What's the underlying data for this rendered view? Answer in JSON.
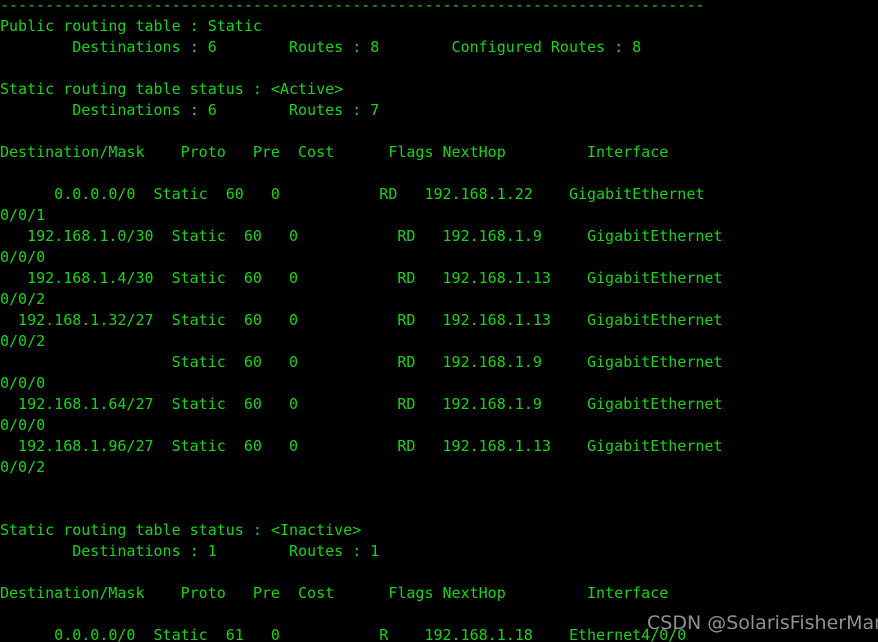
{
  "terminal": {
    "foreground_color": "#16d516",
    "background_color": "#000000",
    "separator": "------------------------------------------------------------------------------",
    "public_table": {
      "label": "Public routing table : Static",
      "summary": "        Destinations : 6        Routes : 8        Configured Routes : 8",
      "destinations_label": "Destinations",
      "destinations_value": "6",
      "routes_label": "Routes",
      "routes_value": "8",
      "configured_routes_label": "Configured Routes",
      "configured_routes_value": "8"
    },
    "active_section": {
      "status_line": "Static routing table status : <Active>",
      "status_label": "Static routing table status",
      "status_value": "<Active>",
      "summary": "        Destinations : 6        Routes : 7",
      "destinations_value": "6",
      "routes_value": "7",
      "header": "Destination/Mask    Proto   Pre  Cost      Flags NextHop         Interface",
      "columns": [
        "Destination/Mask",
        "Proto",
        "Pre",
        "Cost",
        "Flags",
        "NextHop",
        "Interface"
      ],
      "rows": [
        {
          "line1": "      0.0.0.0/0  Static  60   0           RD   192.168.1.22    GigabitEthernet",
          "line2": "0/0/1",
          "destination": "0.0.0.0/0",
          "proto": "Static",
          "pre": "60",
          "cost": "0",
          "flags": "RD",
          "nexthop": "192.168.1.22",
          "interface": "GigabitEthernet0/0/1"
        },
        {
          "line1": "   192.168.1.0/30  Static  60   0           RD   192.168.1.9     GigabitEthernet",
          "line2": "0/0/0",
          "destination": "192.168.1.0/30",
          "proto": "Static",
          "pre": "60",
          "cost": "0",
          "flags": "RD",
          "nexthop": "192.168.1.9",
          "interface": "GigabitEthernet0/0/0"
        },
        {
          "line1": "   192.168.1.4/30  Static  60   0           RD   192.168.1.13    GigabitEthernet",
          "line2": "0/0/2",
          "destination": "192.168.1.4/30",
          "proto": "Static",
          "pre": "60",
          "cost": "0",
          "flags": "RD",
          "nexthop": "192.168.1.13",
          "interface": "GigabitEthernet0/0/2"
        },
        {
          "line1": "  192.168.1.32/27  Static  60   0           RD   192.168.1.13    GigabitEthernet",
          "line2": "0/0/2",
          "destination": "192.168.1.32/27",
          "proto": "Static",
          "pre": "60",
          "cost": "0",
          "flags": "RD",
          "nexthop": "192.168.1.13",
          "interface": "GigabitEthernet0/0/2"
        },
        {
          "line1": "                   Static  60   0           RD   192.168.1.9     GigabitEthernet",
          "line2": "0/0/0",
          "destination": "",
          "proto": "Static",
          "pre": "60",
          "cost": "0",
          "flags": "RD",
          "nexthop": "192.168.1.9",
          "interface": "GigabitEthernet0/0/0"
        },
        {
          "line1": "  192.168.1.64/27  Static  60   0           RD   192.168.1.9     GigabitEthernet",
          "line2": "0/0/0",
          "destination": "192.168.1.64/27",
          "proto": "Static",
          "pre": "60",
          "cost": "0",
          "flags": "RD",
          "nexthop": "192.168.1.9",
          "interface": "GigabitEthernet0/0/0"
        },
        {
          "line1": "  192.168.1.96/27  Static  60   0           RD   192.168.1.13    GigabitEthernet",
          "line2": "0/0/2",
          "destination": "192.168.1.96/27",
          "proto": "Static",
          "pre": "60",
          "cost": "0",
          "flags": "RD",
          "nexthop": "192.168.1.13",
          "interface": "GigabitEthernet0/0/2"
        }
      ]
    },
    "inactive_section": {
      "status_line": "Static routing table status : <Inactive>",
      "status_label": "Static routing table status",
      "status_value": "<Inactive>",
      "summary": "        Destinations : 1        Routes : 1",
      "destinations_value": "1",
      "routes_value": "1",
      "header": "Destination/Mask    Proto   Pre  Cost      Flags NextHop         Interface",
      "columns": [
        "Destination/Mask",
        "Proto",
        "Pre",
        "Cost",
        "Flags",
        "NextHop",
        "Interface"
      ],
      "rows": [
        {
          "line1": "      0.0.0.0/0  Static  61   0           R    192.168.1.18    Ethernet4/0/0",
          "line2": "",
          "destination": "0.0.0.0/0",
          "proto": "Static",
          "pre": "61",
          "cost": "0",
          "flags": "R",
          "nexthop": "192.168.1.18",
          "interface": "Ethernet4/0/0"
        }
      ]
    }
  },
  "watermark": {
    "text": "CSDN @SolarisFisherMan",
    "color": "#b9b9b9"
  }
}
